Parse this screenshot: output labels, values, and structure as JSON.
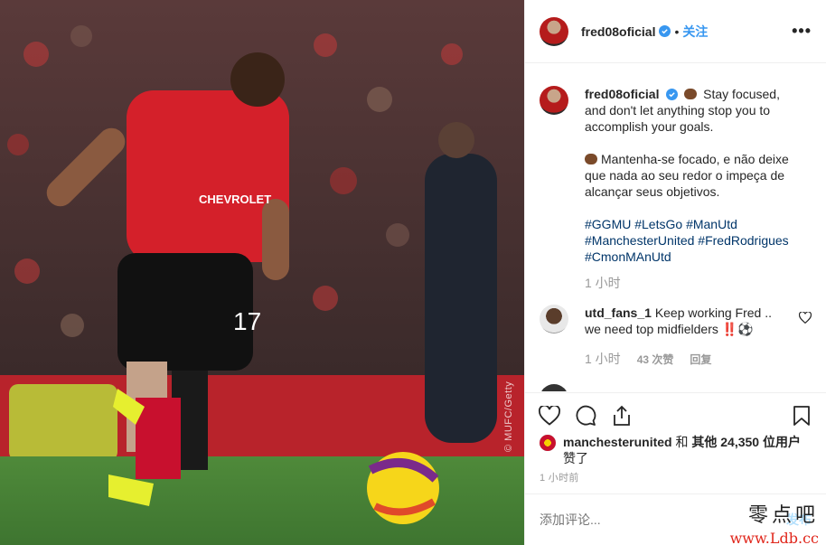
{
  "post": {
    "username": "fred08oficial",
    "dot": "•",
    "follow_label": "关注",
    "more_icon": "•••",
    "caption_en": "Stay focused, and don't let anything stop you to accomplish your goals.",
    "caption_pt": "Mantenha-se focado, e não deixe que nada ao seu redor o impeça de alcançar seus objetivos.",
    "hashtags": [
      "#GGMU",
      "#LetsGo",
      "#ManUtd",
      "#ManchesterUnited",
      "#FredRodrigues",
      "#CmonMAnUtd"
    ],
    "caption_time": "1 小时",
    "photo_credit": "© MUFC/Getty"
  },
  "comments": [
    {
      "username": "utd_fans_1",
      "text": "Keep working Fred .. we need top midfielders ‼️⚽",
      "time": "1 小时",
      "likes": "43 次赞",
      "reply_label": "回复"
    }
  ],
  "likes": {
    "user": "manchesterunited",
    "and": "和",
    "others_prefix": "其他",
    "count": "24,350",
    "others_suffix": "位用户",
    "liked": "赞了"
  },
  "post_time": "1 小时前",
  "add_comment": {
    "placeholder": "添加评论...",
    "post_label": "发布"
  },
  "site_watermark": {
    "name": "零点吧",
    "url": "www.Ldb.cc"
  },
  "colors": {
    "accent": "#3897f0",
    "hashtag": "#003569",
    "muted": "#999999",
    "watermark_url": "#e0261b"
  },
  "icons": [
    "verified-badge-icon",
    "more-options-icon",
    "heart-icon",
    "comment-icon",
    "share-icon",
    "bookmark-icon"
  ]
}
